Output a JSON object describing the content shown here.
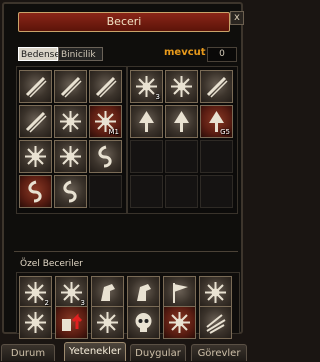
{
  "window": {
    "title": "Beceri",
    "close_label": "x"
  },
  "top_tabs": [
    {
      "label": "Bedensel",
      "active": true
    },
    {
      "label": "Binicilik",
      "active": false
    }
  ],
  "points": {
    "label": "mevcut",
    "value": "0"
  },
  "skills_left": [
    {
      "icon": "slash-skill-icon",
      "badge": ""
    },
    {
      "icon": "double-slash-skill-icon",
      "badge": ""
    },
    {
      "icon": "cross-blades-skill-icon",
      "badge": ""
    },
    {
      "icon": "triple-claw-skill-icon",
      "badge": ""
    },
    {
      "icon": "winged-burst-skill-icon",
      "badge": ""
    },
    {
      "icon": "flame-burst-skill-icon",
      "badge": "M1"
    },
    {
      "icon": "spiked-burst-skill-icon",
      "badge": ""
    },
    {
      "icon": "sword-fist-skill-icon",
      "badge": ""
    },
    {
      "icon": "swirl-skill-icon",
      "badge": ""
    },
    {
      "icon": "flame-swirl-skill-icon",
      "badge": ""
    },
    {
      "icon": "dark-swirl-skill-icon",
      "badge": ""
    },
    {
      "icon": "",
      "badge": ""
    }
  ],
  "skills_right": [
    {
      "icon": "star-burst-skill-icon",
      "badge": "3"
    },
    {
      "icon": "radiant-sun-skill-icon",
      "badge": ""
    },
    {
      "icon": "crossed-swords-skill-icon",
      "badge": ""
    },
    {
      "icon": "tree-shield-skill-icon",
      "badge": ""
    },
    {
      "icon": "tree-banner-skill-icon",
      "badge": ""
    },
    {
      "icon": "red-tree-skill-icon",
      "badge": "G5"
    }
  ],
  "special_section": {
    "label": "Özel Beceriler"
  },
  "special_skills": [
    {
      "icon": "handshake-skill-icon",
      "badge": "2"
    },
    {
      "icon": "scroll-skill-icon",
      "badge": "3"
    },
    {
      "icon": "horse-skill-icon",
      "badge": ""
    },
    {
      "icon": "horse-head-skill-icon",
      "badge": ""
    },
    {
      "icon": "flag-skill-icon",
      "badge": ""
    },
    {
      "icon": "bull-horns-skill-icon",
      "badge": ""
    },
    {
      "icon": "guardian-skill-icon",
      "badge": ""
    },
    {
      "icon": "red-arrow-skill-icon",
      "badge": ""
    },
    {
      "icon": "spiky-aura-skill-icon",
      "badge": ""
    },
    {
      "icon": "skull-skill-icon",
      "badge": ""
    },
    {
      "icon": "flame-aura-skill-icon",
      "badge": ""
    },
    {
      "icon": "cross-banner-skill-icon",
      "badge": ""
    },
    {
      "icon": "dash-strike-skill-icon",
      "badge": ""
    }
  ],
  "bottom_tabs": [
    {
      "label": "Durum",
      "active": false
    },
    {
      "label": "Yetenekler",
      "active": true
    },
    {
      "label": "Duygular",
      "active": false
    },
    {
      "label": "Görevler",
      "active": false
    }
  ]
}
